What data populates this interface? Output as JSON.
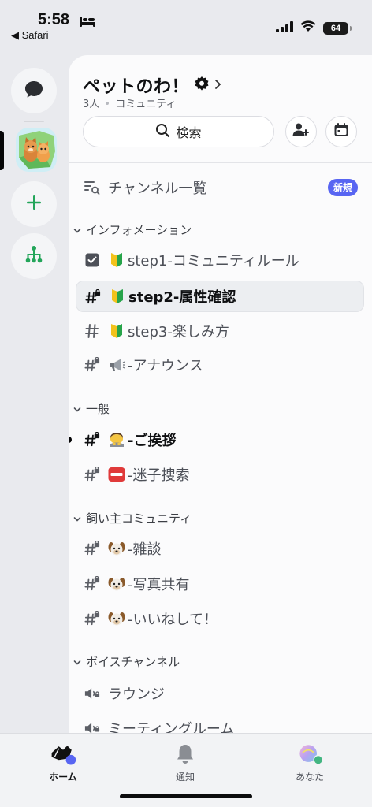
{
  "status_bar": {
    "time": "5:58",
    "back_app": "◀ Safari",
    "battery": "64"
  },
  "server": {
    "name": "ペットのわ！",
    "members": "3人",
    "type": "コミュニティ",
    "search_label": "検索"
  },
  "channel_list": {
    "browse_label": "チャンネル一覧",
    "new_badge": "新規",
    "categories": [
      {
        "name": "インフォメーション",
        "channels": [
          "step1-コミュニティルール",
          "step2-属性確認",
          "step3-楽しみ方",
          "-アナウンス"
        ]
      },
      {
        "name": "一般",
        "channels": [
          "-ご挨拶",
          "-迷子捜索"
        ]
      },
      {
        "name": "飼い主コミュニティ",
        "channels": [
          "-雑談",
          "-写真共有",
          "-いいねして！"
        ]
      },
      {
        "name": "ボイスチャンネル",
        "channels": [
          "ラウンジ",
          "ミーティングルーム"
        ]
      }
    ]
  },
  "tabs": [
    {
      "label": "ホーム",
      "icon": "home-icon"
    },
    {
      "label": "通知",
      "icon": "bell-icon"
    },
    {
      "label": "あなた",
      "icon": "avatar-icon"
    }
  ],
  "colors": {
    "accent": "#5865f2",
    "rail_green": "#23a55a",
    "status_online": "#43b581"
  }
}
